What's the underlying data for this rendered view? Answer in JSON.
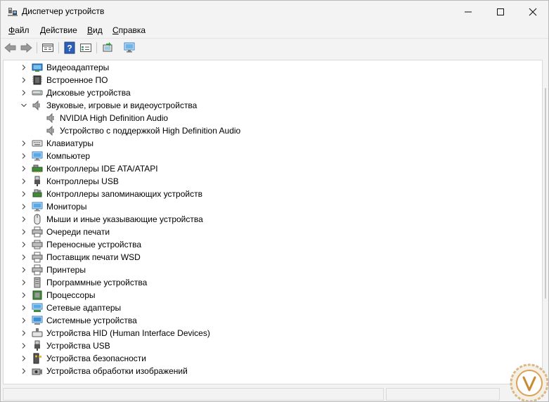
{
  "window": {
    "title": "Диспетчер устройств"
  },
  "menu": {
    "file": {
      "u": "Ф",
      "rest": "айл"
    },
    "action": {
      "u": "Д",
      "rest": "ействие"
    },
    "view": {
      "u": "В",
      "rest": "ид"
    },
    "help": {
      "u": "С",
      "rest": "правка"
    }
  },
  "toolbar": {
    "icons": [
      "back-arrow-icon",
      "forward-arrow-icon",
      "properties-icon",
      "help-icon",
      "details-icon",
      "update-driver-icon",
      "monitor-scan-icon"
    ]
  },
  "tree": {
    "items": [
      {
        "label": "Видеоадаптеры",
        "expanded": false,
        "level": 0,
        "icon": "display-adapter-icon"
      },
      {
        "label": "Встроенное ПО",
        "expanded": false,
        "level": 0,
        "icon": "firmware-chip-icon"
      },
      {
        "label": "Дисковые устройства",
        "expanded": false,
        "level": 0,
        "icon": "disk-drive-icon"
      },
      {
        "label": "Звуковые, игровые и видеоустройства",
        "expanded": true,
        "level": 0,
        "icon": "speaker-icon"
      },
      {
        "label": "NVIDIA High Definition Audio",
        "expanded": null,
        "level": 1,
        "icon": "speaker-icon"
      },
      {
        "label": "Устройство с поддержкой High Definition Audio",
        "expanded": null,
        "level": 1,
        "icon": "speaker-icon"
      },
      {
        "label": "Клавиатуры",
        "expanded": false,
        "level": 0,
        "icon": "keyboard-icon"
      },
      {
        "label": "Компьютер",
        "expanded": false,
        "level": 0,
        "icon": "computer-icon"
      },
      {
        "label": "Контроллеры IDE ATA/ATAPI",
        "expanded": false,
        "level": 0,
        "icon": "ide-controller-icon"
      },
      {
        "label": "Контроллеры USB",
        "expanded": false,
        "level": 0,
        "icon": "usb-plug-icon"
      },
      {
        "label": "Контроллеры запоминающих устройств",
        "expanded": false,
        "level": 0,
        "icon": "storage-controller-icon"
      },
      {
        "label": "Мониторы",
        "expanded": false,
        "level": 0,
        "icon": "monitor-icon"
      },
      {
        "label": "Мыши и иные указывающие устройства",
        "expanded": false,
        "level": 0,
        "icon": "mouse-icon"
      },
      {
        "label": "Очереди печати",
        "expanded": false,
        "level": 0,
        "icon": "printer-icon"
      },
      {
        "label": "Переносные устройства",
        "expanded": false,
        "level": 0,
        "icon": "portable-device-icon"
      },
      {
        "label": "Поставщик печати WSD",
        "expanded": false,
        "level": 0,
        "icon": "printer-icon"
      },
      {
        "label": "Принтеры",
        "expanded": false,
        "level": 0,
        "icon": "printer-icon"
      },
      {
        "label": "Программные устройства",
        "expanded": false,
        "level": 0,
        "icon": "software-device-icon"
      },
      {
        "label": "Процессоры",
        "expanded": false,
        "level": 0,
        "icon": "processor-icon"
      },
      {
        "label": "Сетевые адаптеры",
        "expanded": false,
        "level": 0,
        "icon": "network-adapter-icon"
      },
      {
        "label": "Системные устройства",
        "expanded": false,
        "level": 0,
        "icon": "system-device-icon"
      },
      {
        "label": "Устройства HID (Human Interface Devices)",
        "expanded": false,
        "level": 0,
        "icon": "hid-icon"
      },
      {
        "label": "Устройства USB",
        "expanded": false,
        "level": 0,
        "icon": "usb-plug-icon"
      },
      {
        "label": "Устройства безопасности",
        "expanded": false,
        "level": 0,
        "icon": "security-key-icon"
      },
      {
        "label": "Устройства обработки изображений",
        "expanded": false,
        "level": 0,
        "icon": "camera-icon"
      }
    ]
  },
  "colors": {
    "window_bg": "#f3f3f3",
    "panel_bg": "#ffffff",
    "accent": "#0078d4"
  }
}
